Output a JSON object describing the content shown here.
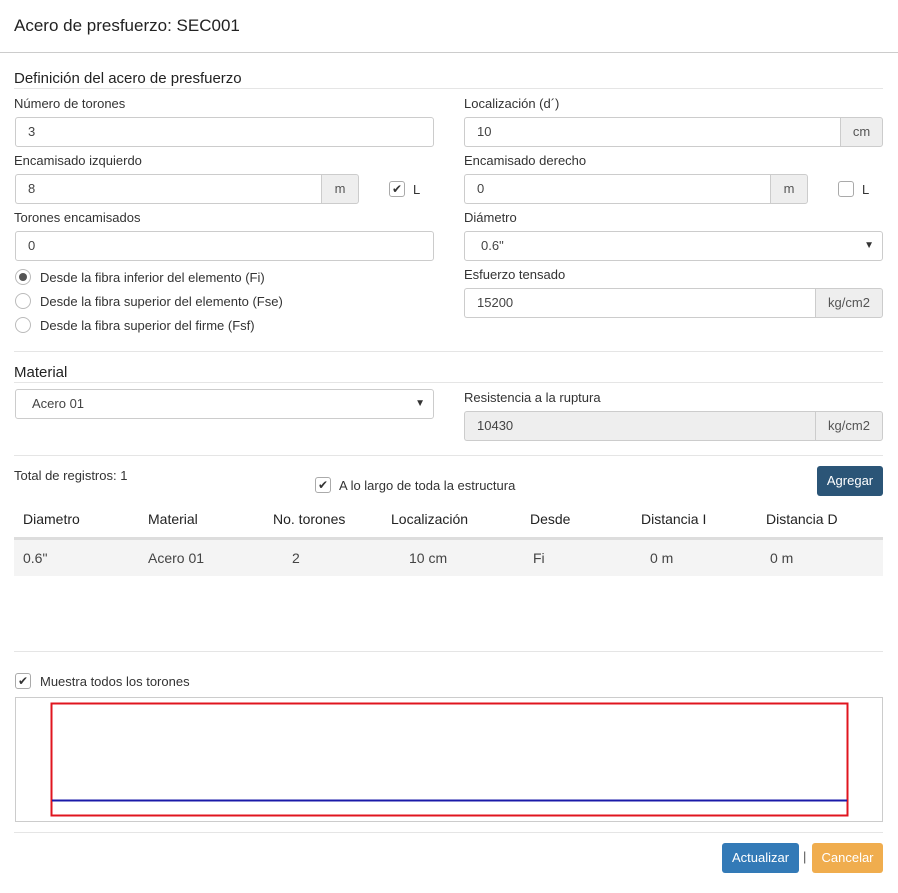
{
  "dialog": {
    "title": "Acero de presfuerzo: SEC001"
  },
  "definition": {
    "section_title": "Definición del acero de presfuerzo",
    "num_torones": {
      "label": "Número de torones",
      "value": "3"
    },
    "localizacion": {
      "label": "Localización (d´)",
      "value": "10",
      "unit": "cm"
    },
    "encamisado_izq": {
      "label": "Encamisado izquierdo",
      "value": "8",
      "unit": "m",
      "check_label": "L",
      "checked": true
    },
    "encamisado_der": {
      "label": "Encamisado derecho",
      "value": "0",
      "unit": "m",
      "check_label": "L",
      "checked": false
    },
    "torones_encamisados": {
      "label": "Torones encamisados",
      "value": "0"
    },
    "diametro": {
      "label": "Diámetro",
      "value": "0.6\""
    },
    "esfuerzo": {
      "label": "Esfuerzo tensado",
      "value": "15200",
      "unit": "kg/cm2"
    },
    "radios": [
      {
        "label": "Desde la fibra inferior del elemento (Fi)",
        "selected": true
      },
      {
        "label": "Desde la fibra superior del elemento (Fse)",
        "selected": false
      },
      {
        "label": "Desde la fibra superior del firme (Fsf)",
        "selected": false
      }
    ]
  },
  "material": {
    "section_title": "Material",
    "select_value": "Acero 01",
    "resistencia": {
      "label": "Resistencia a la ruptura",
      "value": "10430",
      "unit": "kg/cm2"
    }
  },
  "table": {
    "total_label": "Total de registros: 1",
    "along_label": "A lo largo de toda la estructura",
    "along_checked": true,
    "add_button": "Agregar",
    "columns": [
      "Diametro",
      "Material",
      "No. torones",
      "Localización",
      "Desde",
      "Distancia I",
      "Distancia D"
    ],
    "rows": [
      [
        "0.6\"",
        "Acero 01",
        "2",
        "10 cm",
        "Fi",
        "0 m",
        "0 m"
      ]
    ]
  },
  "preview": {
    "show_all_label": "Muestra todos los torones",
    "show_all_checked": true,
    "colors": {
      "outline": "#e0151f",
      "strand": "#1a1aa8"
    }
  },
  "footer": {
    "update_button": "Actualizar",
    "separator": "|",
    "cancel_button": "Cancelar",
    "colors": {
      "primary": "#337ab7",
      "warning": "#f0ad4e",
      "dark": "#2b5577"
    }
  }
}
